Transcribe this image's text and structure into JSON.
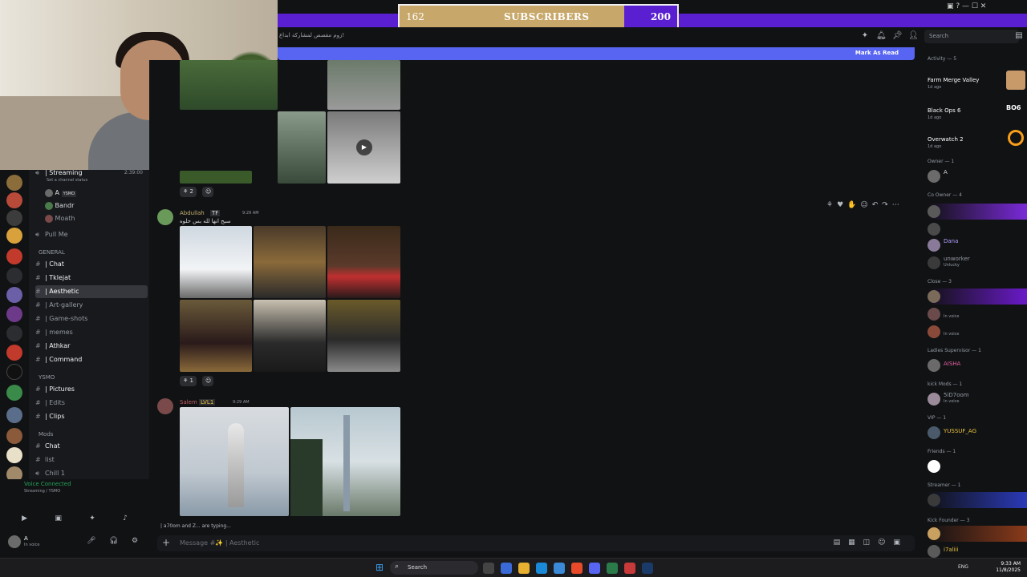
{
  "subs": {
    "current": "162",
    "label": "SUBSCRIBERS",
    "goal": "200",
    "progress": 0.81
  },
  "header": {
    "topic": "زوم مقصص لمشاركة ابداع!",
    "search_placeholder": "Search",
    "mark_read": "Mark As Read"
  },
  "sidebar": {
    "streaming_channel": "| Streaming",
    "stream_time": "2:39:00",
    "channel_status": "Set a channel status",
    "voice_members": [
      "A",
      "Bandr",
      "Moath"
    ],
    "ysmo_tag": "YSMO",
    "pull_me": "Pull Me",
    "cat_general": "GENERAL",
    "channels_general": [
      "| Chat",
      "| Tklejat",
      "| Aesthetic",
      "| Art-gallery",
      "| Game-shots",
      "| memes",
      "| Athkar",
      "| Command"
    ],
    "cat_ysmo": "YSMO",
    "channels_ysmo": [
      "| Pictures",
      "| Edits",
      "| Clips"
    ],
    "cat_mods": "Mods",
    "channels_mods": [
      "Chat",
      "list",
      "Chill 1"
    ],
    "voice_connected": "Voice Connected",
    "voice_detail": "Streaming / YSMO",
    "user_name": "A",
    "user_status": "In voice"
  },
  "chat": {
    "msg1_reaction": "2",
    "msg2_user": "Abdullah",
    "msg2_tag": "TF",
    "msg2_time": "9:29 AM",
    "msg2_text": "سبح انها لله بس حلوه",
    "msg2_reaction": "1",
    "msg3_user": "Salem",
    "msg3_tag": "LVL1",
    "msg3_time": "9:29 AM",
    "typing": "| a70om and Z... are typing...",
    "composer_placeholder": "Message #✨ | Aesthetic"
  },
  "members": {
    "activity_header": "Activity — 5",
    "activities": [
      {
        "game": "Farm Merge Valley",
        "time": "1d ago"
      },
      {
        "game": "Black Ops 6",
        "time": "1d ago"
      },
      {
        "game": "Overwatch 2",
        "time": "1d ago"
      }
    ],
    "owner_header": "Owner — 1",
    "owner": "A",
    "coowner_header": "Co Owner — 4",
    "coowners": [
      "Dana",
      "unworker"
    ],
    "coowner_status": "Unlucky",
    "close_header": "Close — 3",
    "in_voice": "In voice",
    "ladies_header": "Ladies Supervisor — 1",
    "ladies": "AISHA",
    "kick_header": "kick Mods — 1",
    "kick": "5iD7oom",
    "vip_header": "VIP — 1",
    "vip": "YUSSUF_AG",
    "friends_header": "Friends — 1",
    "streamer_header": "Streamer — 1",
    "founder_header": "Kick Founder — 3",
    "founder_last": "i7aliii"
  },
  "taskbar": {
    "search": "Search",
    "lang": "ENG",
    "time": "9:33 AM",
    "date": "11/8/2025"
  },
  "colors": {
    "accent": "#5865f2",
    "subs_bar": "#5a1fd1",
    "subs_fill": "#c8a86a"
  }
}
